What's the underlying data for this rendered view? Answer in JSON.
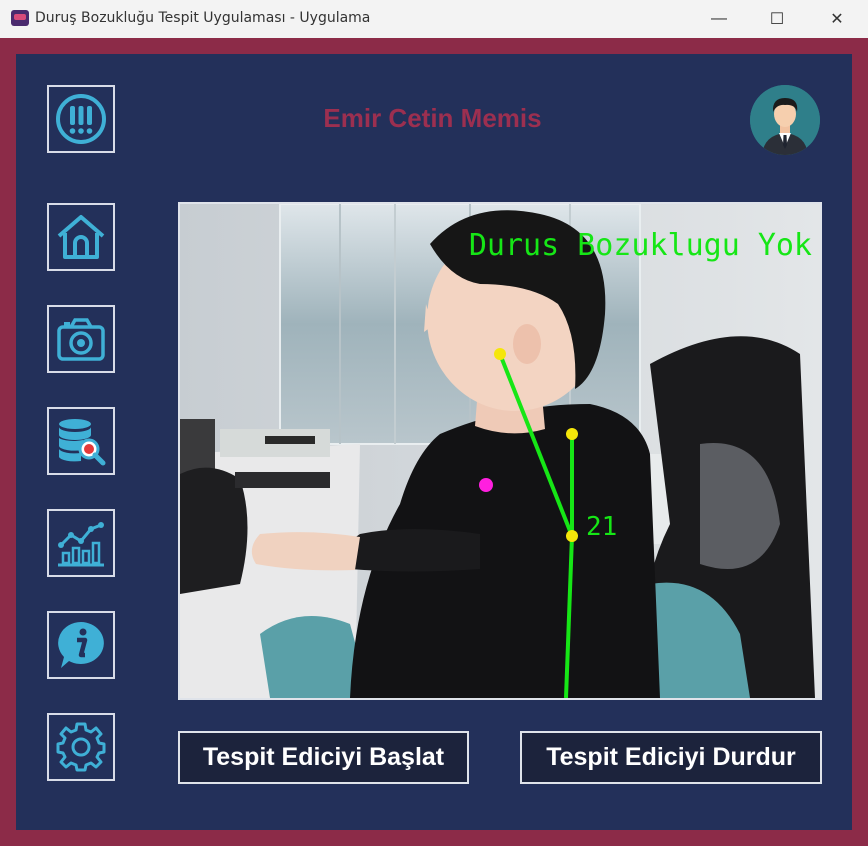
{
  "window": {
    "title": "Duruş Bozukluğu Tespit Uygulaması - Uygulama",
    "minimize_glyph": "—",
    "maximize_glyph": "☐",
    "close_glyph": "✕"
  },
  "header": {
    "username": "Emir Cetin Memis"
  },
  "sidebar": {
    "items": [
      {
        "icon": "alert-icon"
      },
      {
        "icon": "home-icon"
      },
      {
        "icon": "camera-icon"
      },
      {
        "icon": "database-search-icon"
      },
      {
        "icon": "chart-icon"
      },
      {
        "icon": "info-icon"
      },
      {
        "icon": "gear-icon"
      }
    ]
  },
  "camera_feed": {
    "status_text": "Durus Bozuklugu Yok",
    "angle_value": "21"
  },
  "actions": {
    "start_label": "Tespit Ediciyi Başlat",
    "stop_label": "Tespit Ediciyi Durdur"
  },
  "colors": {
    "frame": "#8c2b48",
    "panel": "#23305a",
    "icon_accent": "#3fb0d6",
    "username": "#9c2f50",
    "overlay_green": "#16e616",
    "landmark_yellow": "#f5e60a",
    "landmark_magenta": "#ff1fdf"
  }
}
